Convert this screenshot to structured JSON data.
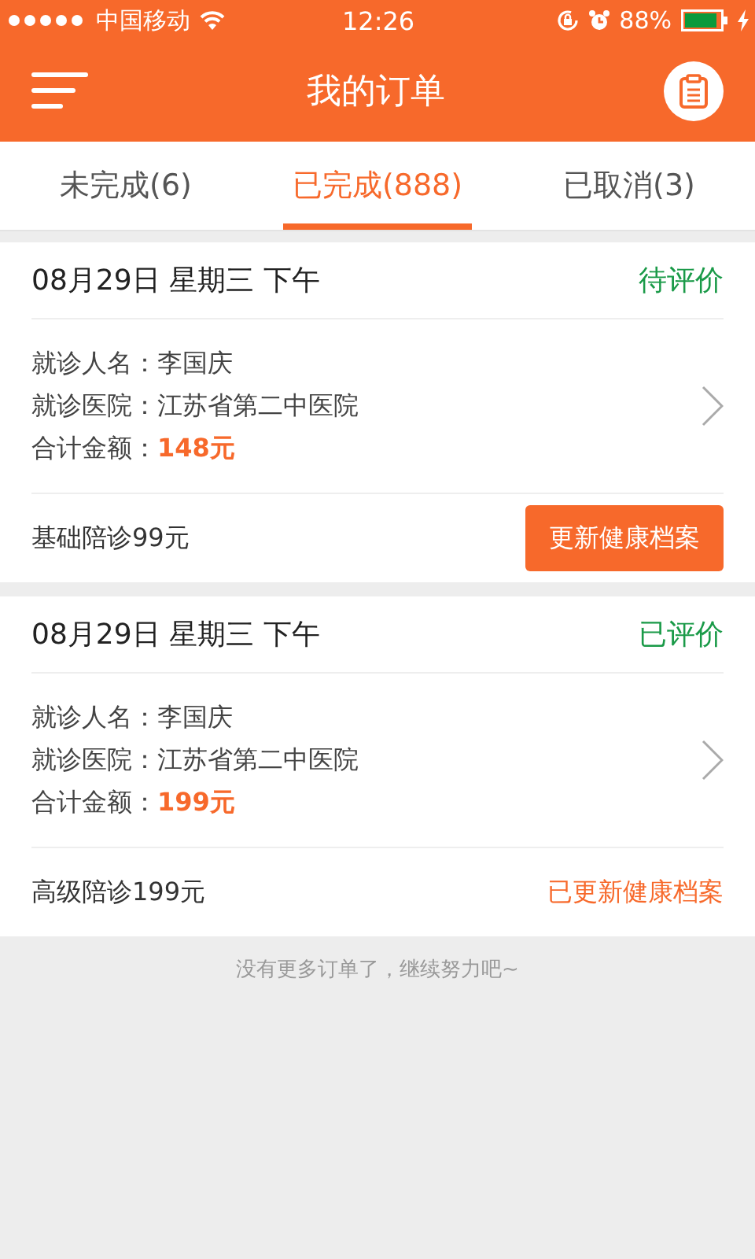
{
  "status_bar": {
    "carrier": "中国移动",
    "time": "12:26",
    "battery": "88%"
  },
  "nav": {
    "title": "我的订单"
  },
  "tabs": [
    {
      "label": "未完成(6)",
      "selected": false
    },
    {
      "label": "已完成(888)",
      "selected": true
    },
    {
      "label": "已取消(3)",
      "selected": false
    }
  ],
  "orders": [
    {
      "date": "08月29日 星期三 下午",
      "status_text": "待评价",
      "fields": [
        {
          "label": "就诊人名：",
          "value": "李国庆",
          "kind": "plain"
        },
        {
          "label": "就诊医院：",
          "value": "江苏省第二中医院",
          "kind": "plain"
        },
        {
          "label": "合计金额：",
          "value": "148元",
          "kind": "amount"
        }
      ],
      "service": "基础陪诊99元",
      "action": {
        "kind": "button",
        "label": "更新健康档案"
      }
    },
    {
      "date": "08月29日 星期三 下午",
      "status_text": "已评价",
      "fields": [
        {
          "label": "就诊人名：",
          "value": "李国庆",
          "kind": "plain"
        },
        {
          "label": "就诊医院：",
          "value": "江苏省第二中医院",
          "kind": "plain"
        },
        {
          "label": "合计金额：",
          "value": "199元",
          "kind": "amount"
        }
      ],
      "service": "高级陪诊199元",
      "action": {
        "kind": "text",
        "label": "已更新健康档案"
      }
    }
  ],
  "end_note": "没有更多订单了，继续努力吧~"
}
